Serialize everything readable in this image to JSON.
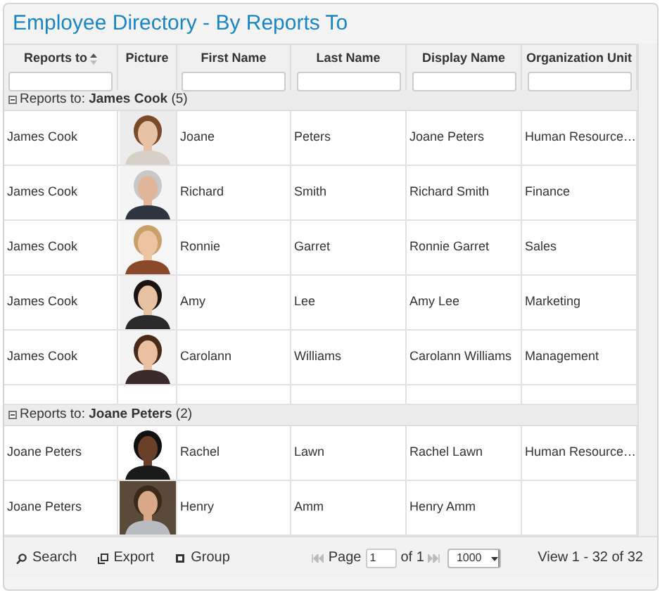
{
  "title": "Employee Directory - By Reports To",
  "columns": [
    {
      "label": "Reports to",
      "sorted": true
    },
    {
      "label": "Picture",
      "sorted": false,
      "filter": false
    },
    {
      "label": "First Name",
      "sorted": false
    },
    {
      "label": "Last Name",
      "sorted": false
    },
    {
      "label": "Display Name",
      "sorted": false
    },
    {
      "label": "Organization Unit",
      "sorted": false
    }
  ],
  "groups": [
    {
      "label": "Reports to: **James Cook** (5)",
      "expanded": true,
      "rows": [
        {
          "reports_to": "James Cook",
          "first_name": "Joane",
          "last_name": "Peters",
          "display_name": "Joane Peters",
          "organization_unit": "Human Resource…"
        },
        {
          "reports_to": "James Cook",
          "first_name": "Richard",
          "last_name": "Smith",
          "display_name": "Richard Smith",
          "organization_unit": "Finance"
        },
        {
          "reports_to": "James Cook",
          "first_name": "Ronnie",
          "last_name": "Garret",
          "display_name": "Ronnie Garret",
          "organization_unit": "Sales"
        },
        {
          "reports_to": "James Cook",
          "first_name": "Amy",
          "last_name": "Lee",
          "display_name": "Amy Lee",
          "organization_unit": "Marketing"
        },
        {
          "reports_to": "James Cook",
          "first_name": "Carolann",
          "last_name": "Williams",
          "display_name": "Carolann Williams",
          "organization_unit": "Management"
        }
      ]
    },
    {
      "label": "Reports to: **Joane Peters** (2)",
      "expanded": true,
      "rows": [
        {
          "reports_to": "Joane Peters",
          "first_name": "Rachel",
          "last_name": "Lawn",
          "display_name": "Rachel Lawn",
          "organization_unit": "Human Resource…"
        },
        {
          "reports_to": "Joane Peters",
          "first_name": "Henry",
          "last_name": "Amm",
          "display_name": "Henry Amm"
        }
      ]
    }
  ],
  "toolbar": [
    {
      "kind": "search",
      "label": "Search"
    },
    {
      "kind": "export",
      "label": "Export"
    },
    {
      "kind": "group",
      "label": "Group"
    }
  ],
  "pager": {
    "page_label": "Page",
    "page": "1",
    "of_label": "of 1",
    "page_size": "1000",
    "summary": "View 1 - 32 of 32"
  }
}
